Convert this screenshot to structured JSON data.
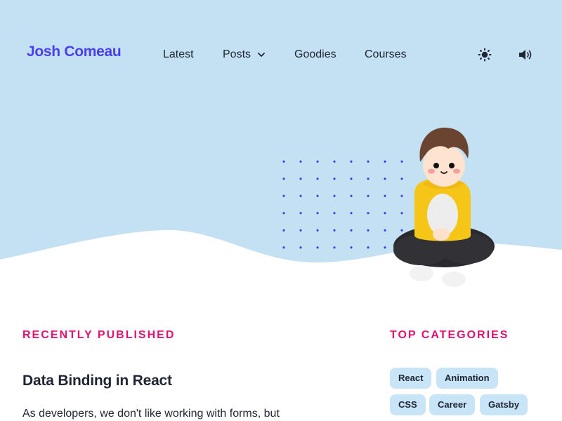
{
  "header": {
    "logo": "Josh Comeau",
    "nav": [
      {
        "label": "Latest"
      },
      {
        "label": "Posts"
      },
      {
        "label": "Goodies"
      },
      {
        "label": "Courses"
      }
    ],
    "actions": {
      "theme_icon": "sun-icon",
      "sound_icon": "speaker-icon"
    }
  },
  "hero": {
    "sky_color": "#c4e1f4",
    "dot_color": "#3b3ee8",
    "avatar": "3d-avatar-illustration"
  },
  "recent": {
    "heading": "Recently Published",
    "posts": [
      {
        "title": "Data Binding in React",
        "excerpt": "As developers, we don't like working with forms, but"
      }
    ]
  },
  "categories": {
    "heading": "Top Categories",
    "tags": [
      {
        "label": "React"
      },
      {
        "label": "Animation"
      },
      {
        "label": "CSS"
      },
      {
        "label": "Career"
      },
      {
        "label": "Gatsby"
      }
    ]
  },
  "colors": {
    "accent": "#e0126e",
    "brand": "#4b3df0",
    "text": "#1f2533",
    "tag_bg": "#c8e4f7"
  }
}
